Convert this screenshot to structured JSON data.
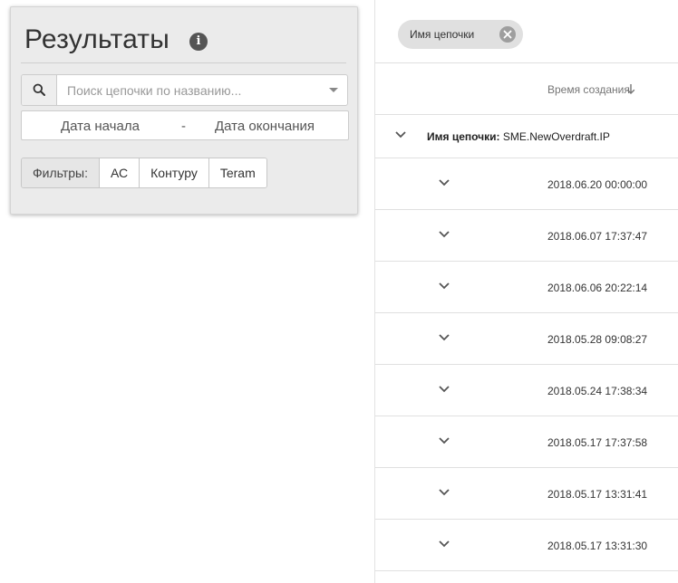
{
  "panel": {
    "title": "Результаты",
    "info_icon": "info-icon",
    "search": {
      "placeholder": "Поиск цепочки по названию...",
      "value": "",
      "icon": "search-icon"
    },
    "date_start_placeholder": "Дата начала",
    "date_separator": "-",
    "date_end_placeholder": "Дата окончания",
    "filters": {
      "label": "Фильтры:",
      "buttons": [
        "АС",
        "Контуру",
        "Teram"
      ]
    }
  },
  "grid": {
    "chip": {
      "label": "Имя цепочки",
      "close_icon": "close-icon"
    },
    "column_header": "Время создания",
    "sort_icon": "arrow-down-icon",
    "group": {
      "key": "Имя цепочки:",
      "value": "SME.NewOverdraft.IP"
    },
    "rows": [
      {
        "date": "2018.06.20 00:00:00"
      },
      {
        "date": "2018.06.07 17:37:47"
      },
      {
        "date": "2018.06.06 20:22:14"
      },
      {
        "date": "2018.05.28 09:08:27"
      },
      {
        "date": "2018.05.24 17:38:34"
      },
      {
        "date": "2018.05.17 17:37:58"
      },
      {
        "date": "2018.05.17 13:31:41"
      },
      {
        "date": "2018.05.17 13:31:30"
      }
    ]
  },
  "colors": {
    "card_bg": "#ebebeb",
    "chip_bg": "#e0e0e0",
    "divider": "#e0e0e0"
  }
}
